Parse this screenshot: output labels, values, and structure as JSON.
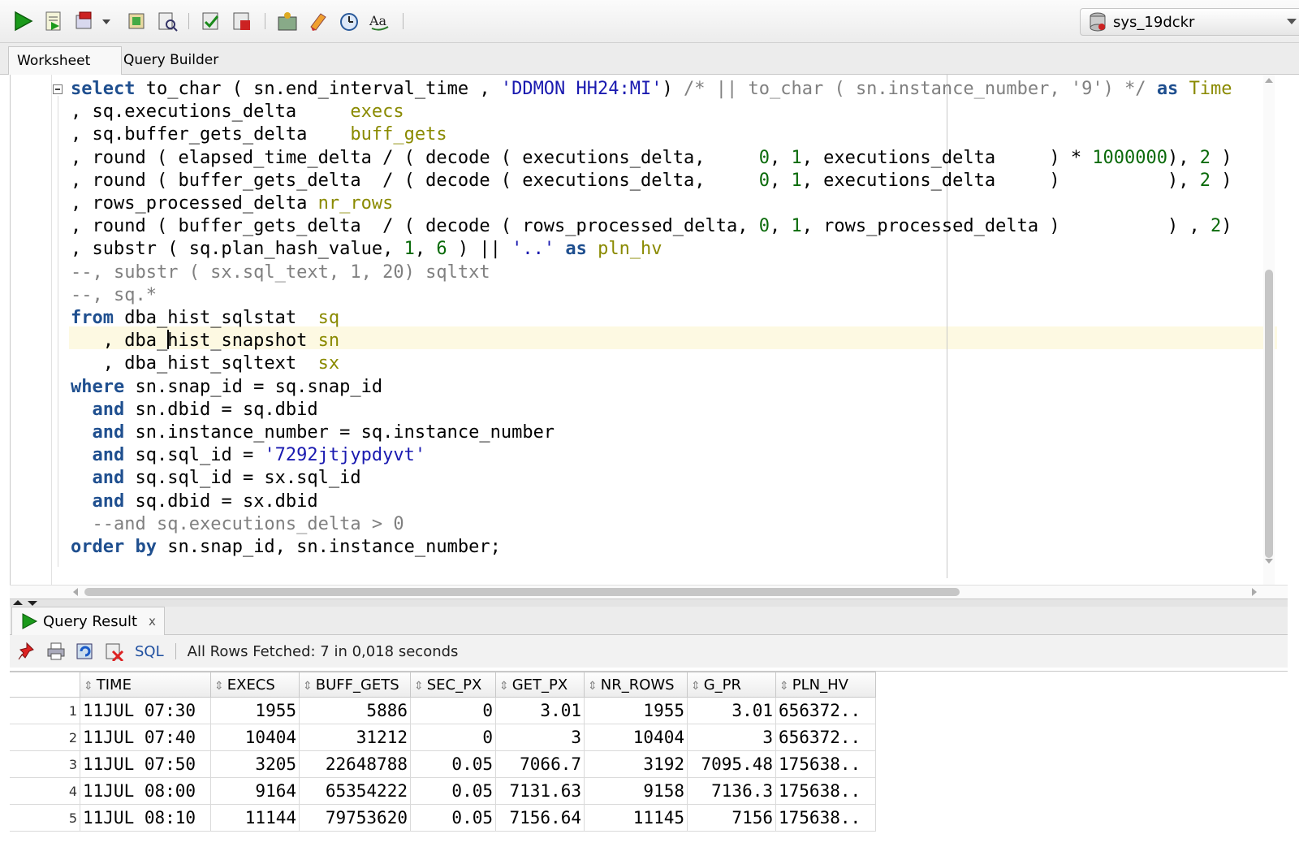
{
  "toolbar": {
    "buttons": [
      {
        "name": "run-statement-icon"
      },
      {
        "name": "run-script-icon"
      },
      {
        "name": "commit-icon"
      },
      {
        "name": "rollback-icon"
      },
      {
        "name": "explain-plan-icon"
      },
      {
        "name": "autotrace-icon"
      },
      {
        "name": "sql-tuning-advisor-icon"
      },
      {
        "name": "clear-icon"
      },
      {
        "name": "sql-history-icon"
      },
      {
        "name": "format-case-icon"
      }
    ],
    "connection": "sys_19dckr"
  },
  "tabs": [
    "Worksheet",
    "Query Builder"
  ],
  "editor": {
    "lines": [
      "select to_char ( sn.end_interval_time , 'DDMON HH24:MI') /* || to_char ( sn.instance_number, '9') */ as Time",
      ", sq.executions_delta     execs",
      ", sq.buffer_gets_delta    buff_gets",
      ", round ( elapsed_time_delta / ( decode ( executions_delta,     0, 1, executions_delta     ) * 1000000), 2 )",
      ", round ( buffer_gets_delta  / ( decode ( executions_delta,     0, 1, executions_delta     )          ), 2 )",
      ", rows_processed_delta nr_rows",
      ", round ( buffer_gets_delta  / ( decode ( rows_processed_delta, 0, 1, rows_processed_delta )          ) , 2)",
      ", substr ( sq.plan_hash_value, 1, 6 ) || '..' as pln_hv",
      "--, substr ( sx.sql_text, 1, 20) sqltxt",
      "--, sq.*",
      "from dba_hist_sqlstat  sq",
      "   , dba_hist_snapshot sn",
      "   , dba_hist_sqltext  sx",
      "where sn.snap_id = sq.snap_id",
      "  and sn.dbid = sq.dbid",
      "  and sn.instance_number = sq.instance_number",
      "  and sq.sql_id = '7292jtjypdyvt'",
      "  and sq.sql_id = sx.sql_id",
      "  and sq.dbid = sx.dbid",
      "  --and sq.executions_delta > 0",
      "order by sn.snap_id, sn.instance_number;"
    ]
  },
  "result": {
    "tab_label": "Query Result",
    "tab_close": "x",
    "sql_link": "SQL",
    "status": "All Rows Fetched: 7 in 0,018 seconds",
    "columns": [
      "TIME",
      "EXECS",
      "BUFF_GETS",
      "SEC_PX",
      "GET_PX",
      "NR_ROWS",
      "G_PR",
      "PLN_HV"
    ],
    "rows": [
      {
        "n": "1",
        "cells": [
          "11JUL 07:30",
          "1955",
          "5886",
          "0",
          "3.01",
          "1955",
          "3.01",
          "656372.."
        ]
      },
      {
        "n": "2",
        "cells": [
          "11JUL 07:40",
          "10404",
          "31212",
          "0",
          "3",
          "10404",
          "3",
          "656372.."
        ]
      },
      {
        "n": "3",
        "cells": [
          "11JUL 07:50",
          "3205",
          "22648788",
          "0.05",
          "7066.7",
          "3192",
          "7095.48",
          "175638.."
        ]
      },
      {
        "n": "4",
        "cells": [
          "11JUL 08:00",
          "9164",
          "65354222",
          "0.05",
          "7131.63",
          "9158",
          "7136.3",
          "175638.."
        ]
      },
      {
        "n": "5",
        "cells": [
          "11JUL 08:10",
          "11144",
          "79753620",
          "0.05",
          "7156.64",
          "11145",
          "7156",
          "175638.."
        ]
      }
    ]
  },
  "colors": {
    "keyword": "#1f4f8f",
    "alias": "#8a8a00",
    "string": "#1a1ab0",
    "number": "#0a6a0a",
    "comment": "#808080",
    "current_line": "#fdf9e2"
  }
}
